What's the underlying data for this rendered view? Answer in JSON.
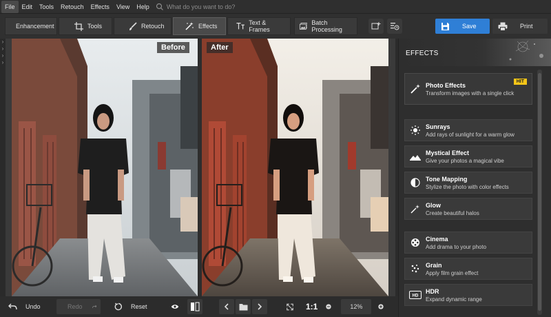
{
  "menu": {
    "items": [
      "File",
      "Edit",
      "Tools",
      "Retouch",
      "Effects",
      "View",
      "Help"
    ],
    "search_placeholder": "What do you want to do?"
  },
  "tabs": [
    {
      "label": "Enhancement",
      "icon": "sliders-icon"
    },
    {
      "label": "Tools",
      "icon": "crop-icon"
    },
    {
      "label": "Retouch",
      "icon": "brush-icon"
    },
    {
      "label": "Effects",
      "icon": "magic-wand-icon",
      "active": true
    },
    {
      "label": "Text & Frames",
      "icon": "text-icon"
    },
    {
      "label": "Batch Processing",
      "icon": "images-icon"
    }
  ],
  "actions": {
    "save": "Save",
    "print": "Print"
  },
  "canvas": {
    "before_label": "Before",
    "after_label": "After"
  },
  "panel": {
    "title": "EFFECTS",
    "hero": {
      "title": "Photo Effects",
      "desc": "Transform images with a single click",
      "badge": "HIT",
      "icon": "magic-wand-icon"
    },
    "items": [
      {
        "title": "Sunrays",
        "desc": "Add rays of sunlight for a warm glow",
        "icon": "sun-icon"
      },
      {
        "title": "Mystical Effect",
        "desc": "Give your photos a magical vibe",
        "icon": "landscape-icon"
      },
      {
        "title": "Tone Mapping",
        "desc": "Stylize the photo with color effects",
        "icon": "half-circle-icon"
      },
      {
        "title": "Glow",
        "desc": "Create beautiful halos",
        "icon": "sparkle-icon"
      },
      {
        "title": "Cinema",
        "desc": "Add drama to your photo",
        "icon": "film-reel-icon"
      },
      {
        "title": "Grain",
        "desc": "Apply film grain effect",
        "icon": "grain-icon"
      },
      {
        "title": "HDR",
        "desc": "Expand dynamic range",
        "icon": "hdr-icon"
      }
    ]
  },
  "bottom": {
    "undo": "Undo",
    "redo": "Redo",
    "reset": "Reset",
    "ratio": "1:1",
    "zoom": "12%"
  },
  "colors": {
    "accent": "#2f7fd6",
    "badge": "#f5c518"
  }
}
